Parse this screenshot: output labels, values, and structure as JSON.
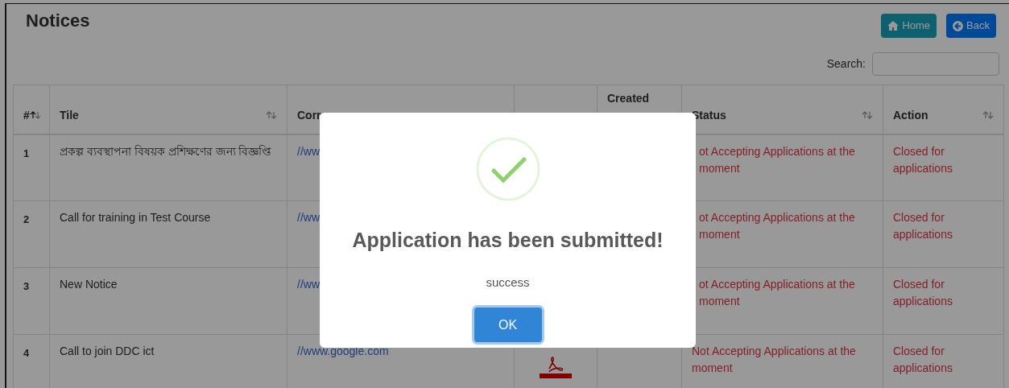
{
  "page": {
    "title": "Notices",
    "buttons": [
      {
        "kind": "home",
        "label": "Home"
      },
      {
        "kind": "back",
        "label": "Back"
      }
    ],
    "search": {
      "label": "Search:"
    }
  },
  "table": {
    "columns": [
      {
        "label": "#",
        "sorted_ascending": true
      },
      {
        "label": "Tile",
        "sorted_ascending": false
      },
      {
        "label": "Corr"
      },
      {},
      {
        "label": "Created"
      },
      {
        "label": "Status",
        "sorted_ascending": false
      },
      {
        "label": "Action",
        "sorted_ascending": false
      }
    ],
    "rows": [
      {
        "number": "1",
        "title": "প্রকল্প ব্যবস্থাপনা বিষয়ক প্রশিক্ষণের জন্য বিজ্ঞপ্তি",
        "link": "//ww",
        "attachment": false,
        "status": "ot Accepting Applications at the moment",
        "action": "Closed for applications"
      },
      {
        "number": "2",
        "title": "Call for training in Test Course",
        "link": "//ww",
        "attachment": false,
        "status": "ot Accepting Applications at the moment",
        "action": "Closed for applications"
      },
      {
        "number": "3",
        "title": "New Notice",
        "link": "//ww",
        "attachment": false,
        "status": "ot Accepting Applications at the moment",
        "action": "Closed for applications"
      },
      {
        "number": "4",
        "title": "Call to join DDC ict",
        "link": "//www.google.com",
        "attachment": true,
        "status": "Not Accepting Applications at the moment",
        "action": "Closed for applications"
      }
    ]
  },
  "dialog": {
    "title": "Application has been submitted!",
    "message": "success",
    "button": "OK"
  }
}
